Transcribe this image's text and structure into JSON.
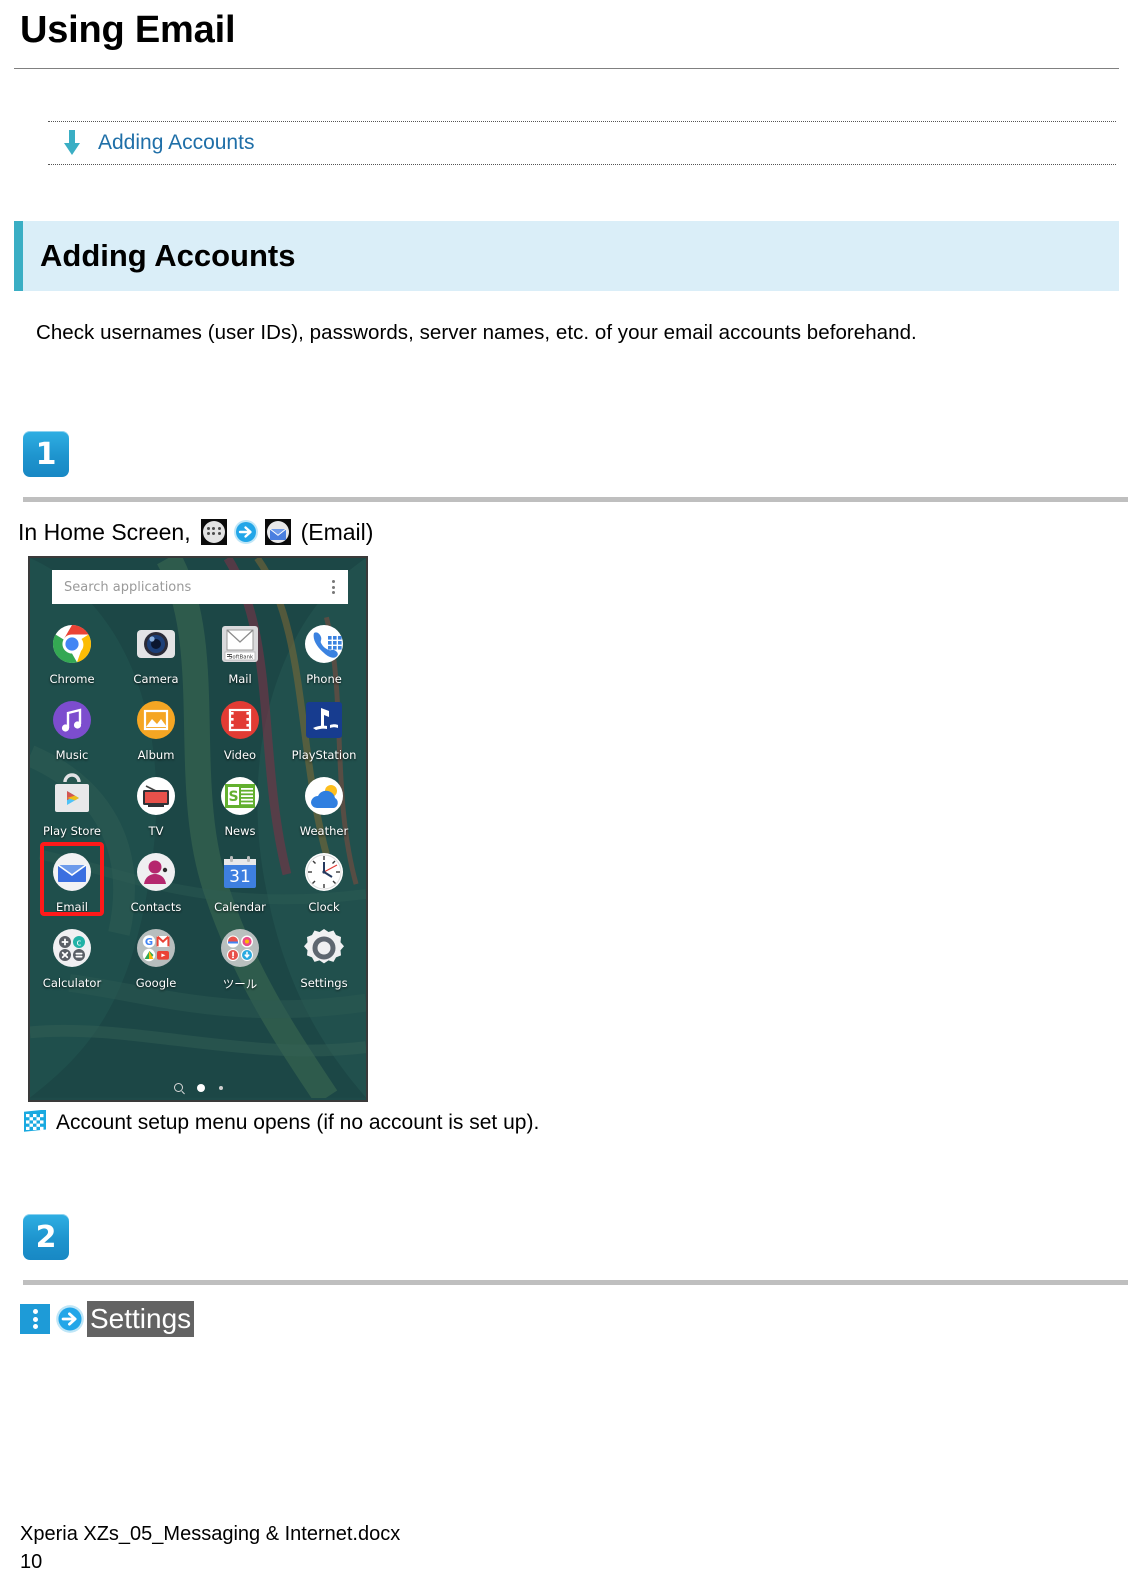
{
  "document": {
    "title": "Using Email",
    "footer_filename": "Xperia XZs_05_Messaging & Internet.docx",
    "footer_page_number": "10"
  },
  "nav": {
    "arrow_icon": "arrow-down-icon",
    "link_label": "Adding Accounts",
    "link_color": "#1F6FA8",
    "arrow_color": "#3AAEC4"
  },
  "section": {
    "heading": "Adding Accounts",
    "band_background": "#DAEEF8",
    "accent_color": "#3AAEC4",
    "intro_paragraph": "Check usernames (user IDs), passwords, server names, etc. of your email accounts beforehand."
  },
  "steps": [
    {
      "badge": "1",
      "badge_color": "#1E94CE",
      "instruction_prefix": "In Home Screen,",
      "icons": [
        "app-drawer-icon",
        "arrow-right-circle-icon",
        "email-icon"
      ],
      "instruction_suffix": "(Email)",
      "result_text": "Account setup menu opens (if no account is set up).",
      "result_icon": "checkered-flag-icon"
    },
    {
      "badge": "2",
      "badge_color": "#1E94CE",
      "icons": [
        "overflow-menu-icon",
        "arrow-right-circle-icon"
      ],
      "highlight_label": "Settings",
      "highlight_background": "#636363",
      "highlight_text_color": "#FFFFFF"
    }
  ],
  "phone_screenshot": {
    "search_placeholder": "Search applications",
    "overflow_icon": "kebab-menu-icon",
    "highlighted_app": "Email",
    "highlight_color": "#FF1A1A",
    "page_indicator": [
      "search-icon",
      "dot-active",
      "dot-inactive"
    ],
    "apps": [
      {
        "label": "Chrome",
        "icon": "chrome-icon"
      },
      {
        "label": "Camera",
        "icon": "camera-icon"
      },
      {
        "label": "Mail",
        "icon": "softbank-mail-icon"
      },
      {
        "label": "Phone",
        "icon": "phone-icon"
      },
      {
        "label": "Music",
        "icon": "music-icon"
      },
      {
        "label": "Album",
        "icon": "album-icon"
      },
      {
        "label": "Video",
        "icon": "video-icon"
      },
      {
        "label": "PlayStation",
        "icon": "playstation-icon"
      },
      {
        "label": "Play Store",
        "icon": "play-store-icon"
      },
      {
        "label": "TV",
        "icon": "tv-icon"
      },
      {
        "label": "News",
        "icon": "news-icon"
      },
      {
        "label": "Weather",
        "icon": "weather-icon"
      },
      {
        "label": "Email",
        "icon": "email-icon"
      },
      {
        "label": "Contacts",
        "icon": "contacts-icon"
      },
      {
        "label": "Calendar",
        "icon": "calendar-icon"
      },
      {
        "label": "Clock",
        "icon": "clock-icon"
      },
      {
        "label": "Calculator",
        "icon": "calculator-icon"
      },
      {
        "label": "Google",
        "icon": "google-folder-icon"
      },
      {
        "label": "ツール",
        "icon": "tools-folder-icon"
      },
      {
        "label": "Settings",
        "icon": "settings-icon"
      }
    ],
    "calendar_day": "31",
    "news_letter": "S",
    "mail_carrier": "SoftBank"
  }
}
